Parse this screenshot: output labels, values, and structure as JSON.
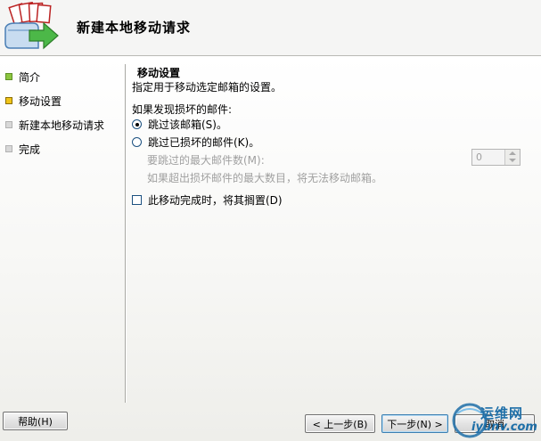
{
  "header": {
    "title": "新建本地移动请求"
  },
  "nav": {
    "items": [
      {
        "label": "简介",
        "state": "done"
      },
      {
        "label": "移动设置",
        "state": "current"
      },
      {
        "label": "新建本地移动请求",
        "state": "pending"
      },
      {
        "label": "完成",
        "state": "pending"
      }
    ]
  },
  "content": {
    "section_title": "移动设置",
    "section_description": "指定用于移动选定邮箱的设置。",
    "group_label": "如果发现损坏的邮件:",
    "radio_skip_mailbox": "跳过该邮箱(S)。",
    "radio_skip_messages": "跳过已损坏的邮件(K)。",
    "max_messages_label": "要跳过的最大邮件数(M):",
    "max_messages_value": "0",
    "max_messages_note": "如果超出损坏邮件的最大数目，将无法移动邮箱。",
    "suspend_checkbox": "此移动完成时，将其搁置(D)",
    "selected_option": "skip_mailbox",
    "suspend_checked": false
  },
  "footer": {
    "help": "帮助(H)",
    "back": "< 上一步(B)",
    "next": "下一步(N) >",
    "cancel": "取消"
  },
  "watermark": {
    "name": "运维网",
    "url": "iyunv.com"
  },
  "colors": {
    "accent_blue": "#1c5180",
    "done_marker": "#8cc63f",
    "current_marker": "#f0c419",
    "pending_marker": "#d8d8d8",
    "watermark_blue": "#1e6fa8"
  }
}
